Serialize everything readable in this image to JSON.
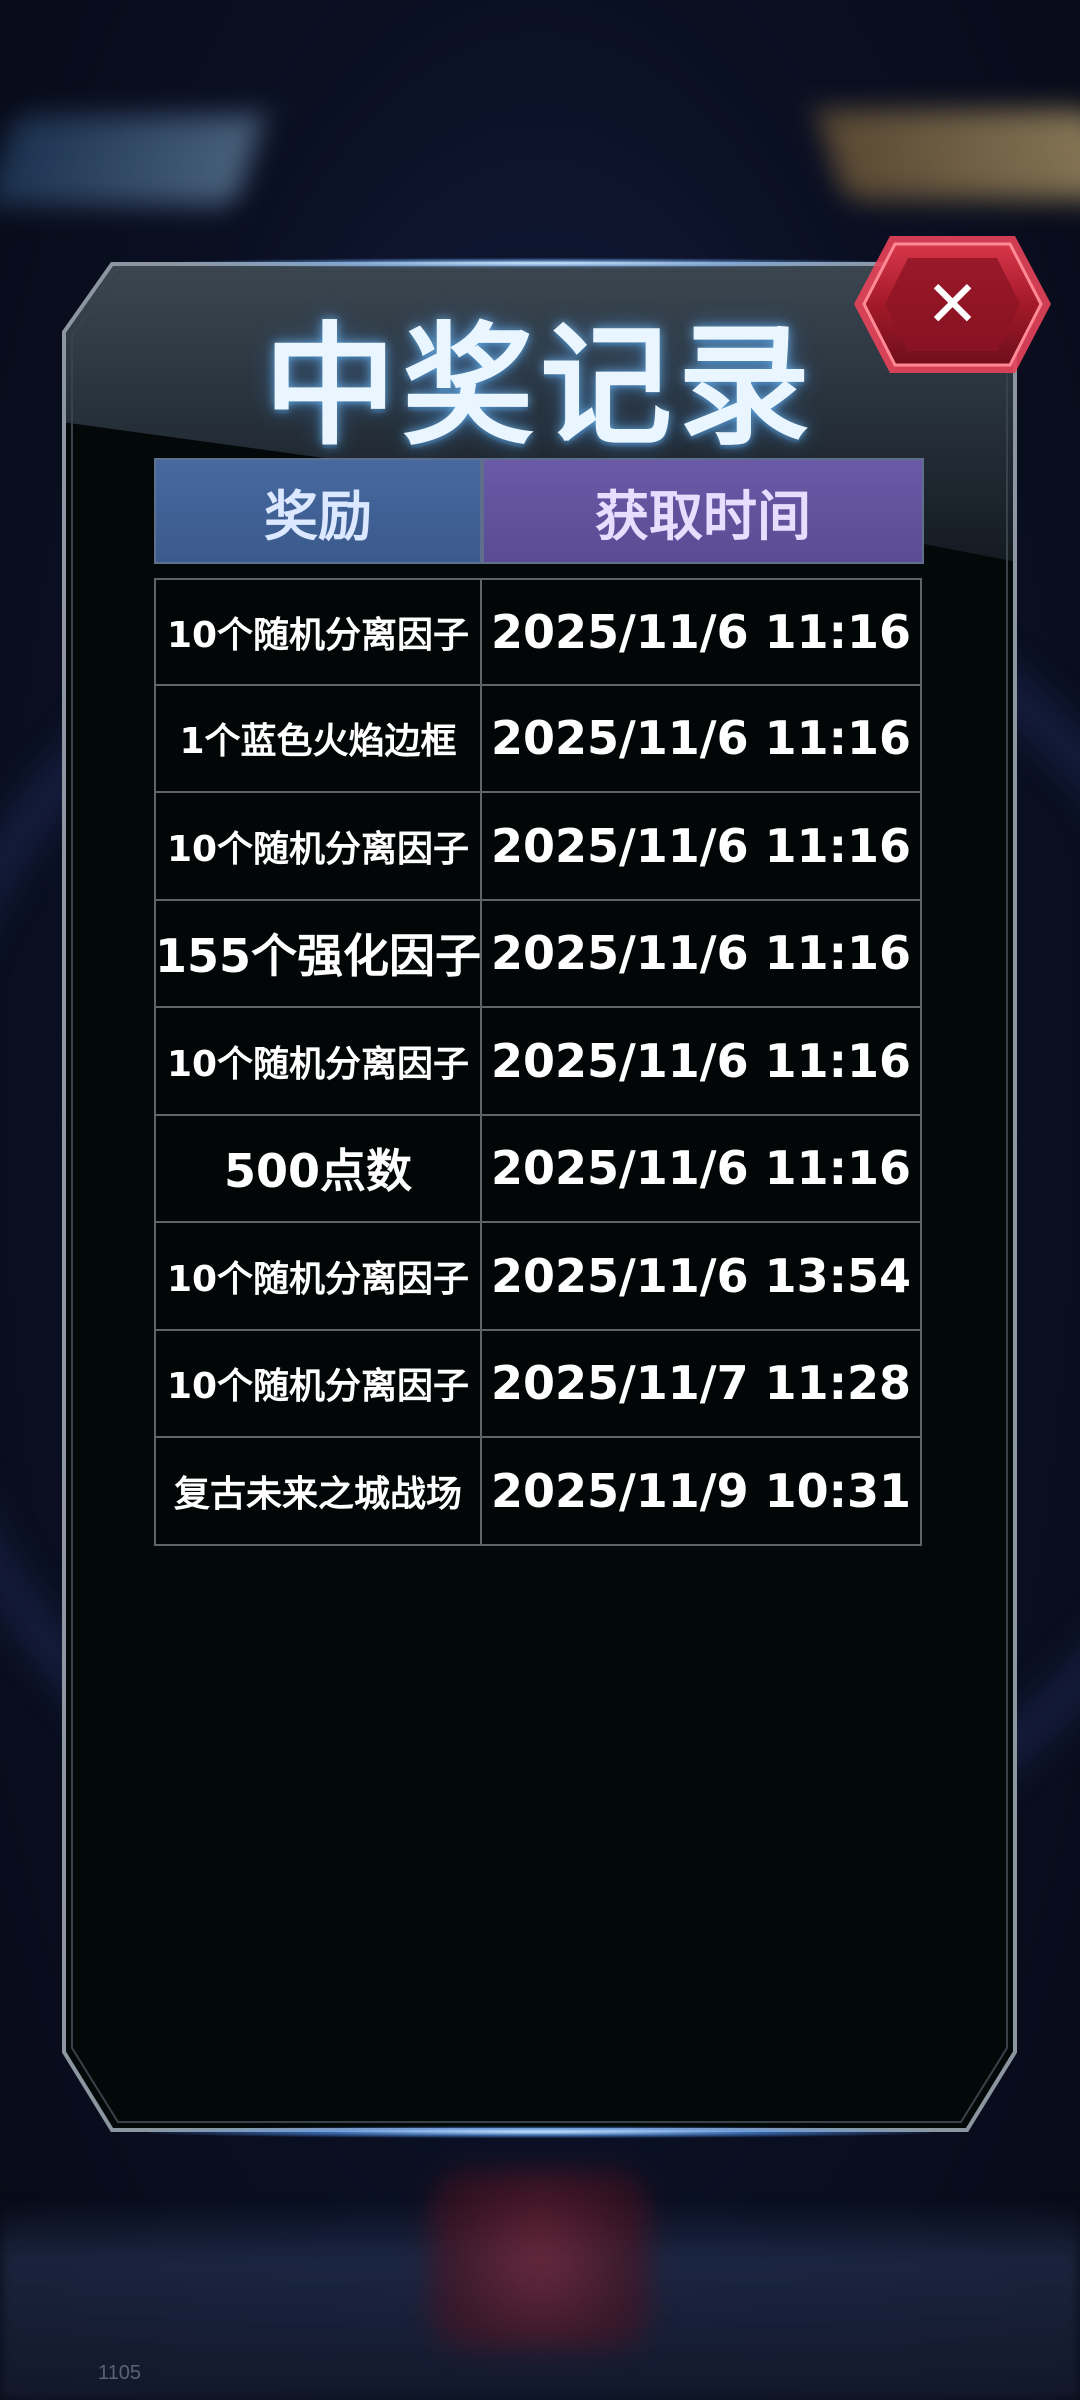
{
  "dialog": {
    "title": "中奖记录",
    "close_icon_glyph": "✕",
    "close_icon": "close-icon"
  },
  "table": {
    "headers": {
      "reward": "奖励",
      "time": "获取时间"
    },
    "rows": [
      {
        "reward": "10个随机分离因子",
        "time": "2025/11/6 11:16"
      },
      {
        "reward": "1个蓝色火焰边框",
        "time": "2025/11/6 11:16"
      },
      {
        "reward": "10个随机分离因子",
        "time": "2025/11/6 11:16"
      },
      {
        "reward": "155个强化因子",
        "time": "2025/11/6 11:16"
      },
      {
        "reward": "10个随机分离因子",
        "time": "2025/11/6 11:16"
      },
      {
        "reward": "500点数",
        "time": "2025/11/6 11:16"
      },
      {
        "reward": "10个随机分离因子",
        "time": "2025/11/6 13:54"
      },
      {
        "reward": "10个随机分离因子",
        "time": "2025/11/7 11:28"
      },
      {
        "reward": "复古未来之城战场",
        "time": "2025/11/9 10:31"
      }
    ]
  },
  "footer": {
    "version": "1105"
  },
  "colors": {
    "header_reward_bg": "#3f6196",
    "header_time_bg": "#604f9b",
    "panel_bg": "#030809",
    "close_button_red": "#b31d2c"
  }
}
